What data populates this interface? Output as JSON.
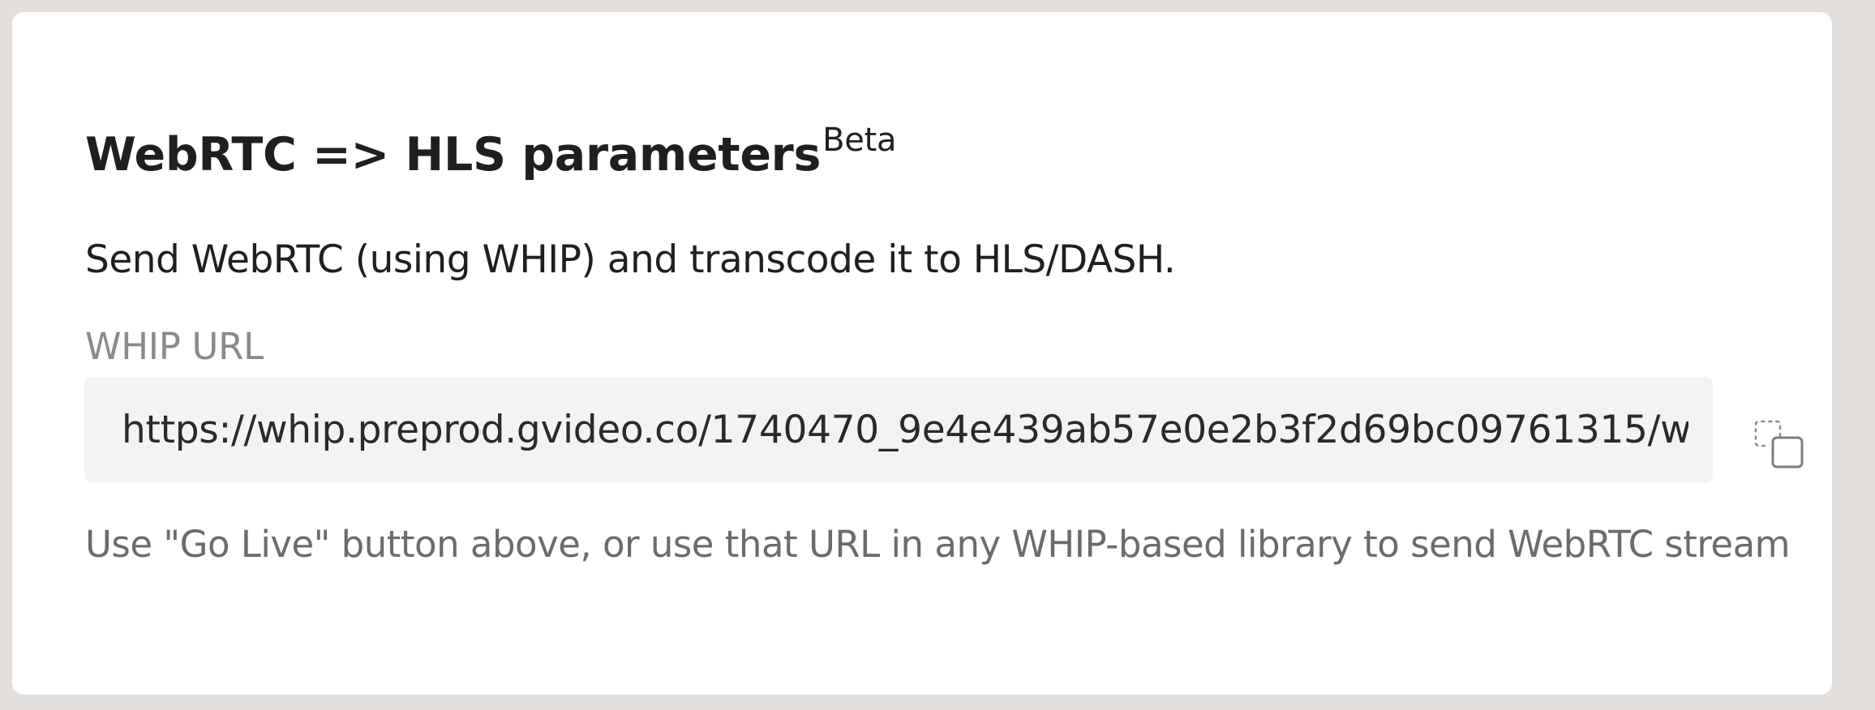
{
  "section": {
    "title": "WebRTC => HLS parameters",
    "title_badge": "Beta",
    "description": "Send WebRTC (using WHIP) and transcode it to HLS/DASH.",
    "field": {
      "label": "WHIP URL",
      "value": "https://whip.preprod.gvideo.co/1740470_9e4e439ab57e0e2b3f2d69bc09761315/w",
      "copy_icon": "copy-icon"
    },
    "hint": "Use \"Go Live\" button above, or use that URL in any WHIP-based library to send WebRTC stream"
  },
  "colors": {
    "frame_background": "#e2dfdd",
    "card_background": "#ffffff",
    "field_background": "#f3f3f3",
    "text_primary": "#1f1f1f",
    "text_label": "#8a8a8a",
    "text_hint": "#6b6b6b"
  }
}
